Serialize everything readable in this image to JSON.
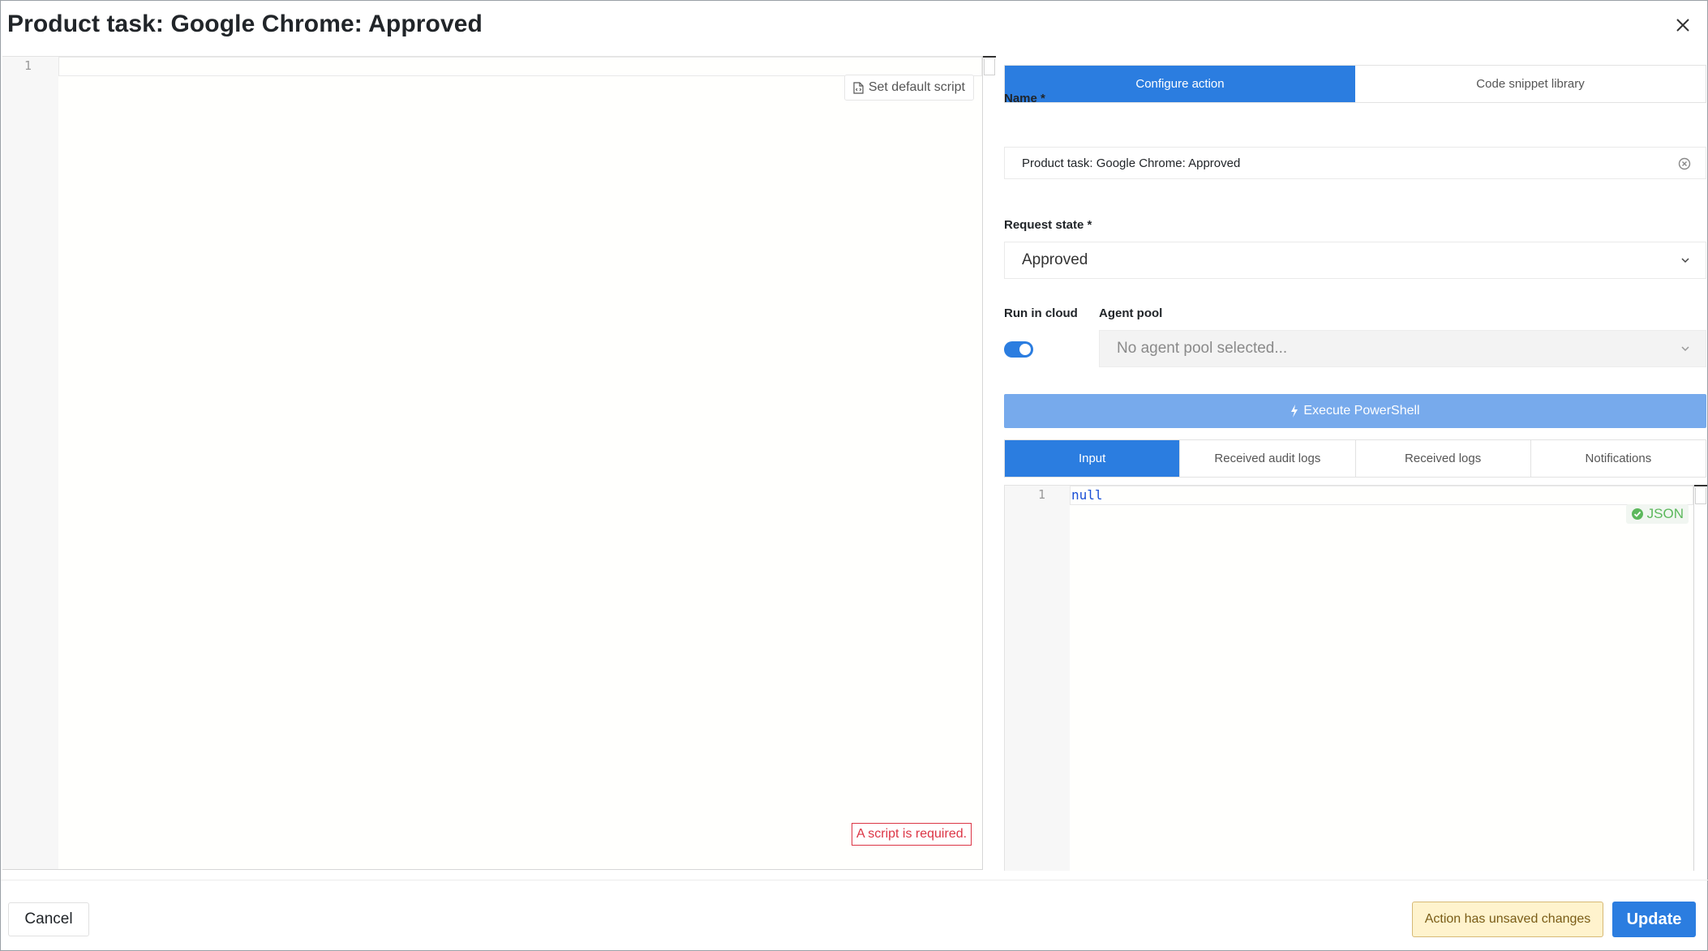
{
  "dialog": {
    "title": "Product task: Google Chrome: Approved"
  },
  "script_editor": {
    "line_numbers": [
      "1"
    ],
    "set_default_label": "Set default script",
    "error_message": "A script is required."
  },
  "panel": {
    "tabs": [
      {
        "label": "Configure action",
        "active": true
      },
      {
        "label": "Code snippet library",
        "active": false
      }
    ],
    "name_label": "Name *",
    "name_value": "Product task: Google Chrome: Approved",
    "request_state_label": "Request state *",
    "request_state_value": "Approved",
    "run_in_cloud_label": "Run in cloud",
    "run_in_cloud_enabled": true,
    "agent_pool_label": "Agent pool",
    "agent_pool_placeholder": "No agent pool selected...",
    "execute_label": "Execute PowerShell",
    "output_tabs": [
      {
        "label": "Input",
        "active": true
      },
      {
        "label": "Received audit logs",
        "active": false
      },
      {
        "label": "Received logs",
        "active": false
      },
      {
        "label": "Notifications",
        "active": false
      }
    ],
    "json_editor": {
      "line_numbers": [
        "1"
      ],
      "code": "null",
      "badge": "JSON"
    }
  },
  "footer": {
    "cancel_label": "Cancel",
    "unsaved_message": "Action has unsaved changes",
    "update_label": "Update"
  },
  "colors": {
    "primary": "#2b7de0",
    "primary_disabled": "#77aaec",
    "error": "#dc3545",
    "warning_bg": "#fff3cd",
    "success": "#5cb85c"
  }
}
